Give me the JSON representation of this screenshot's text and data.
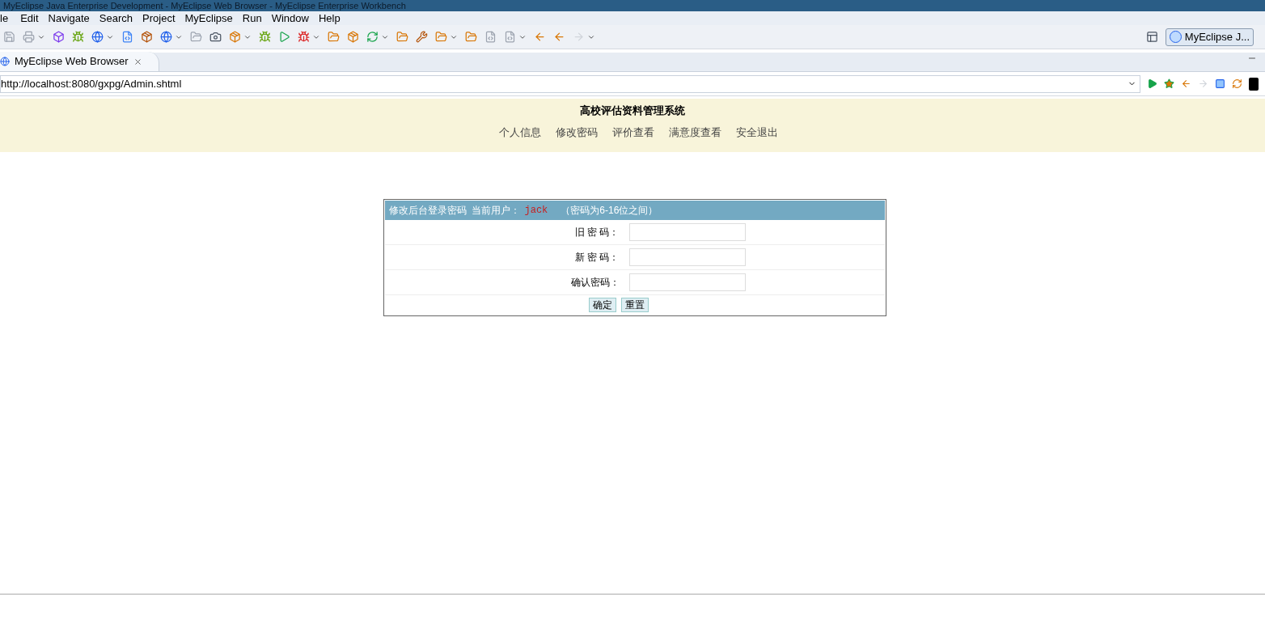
{
  "window": {
    "title": "MyEclipse Java Enterprise Development - MyEclipse Web Browser - MyEclipse Enterprise Workbench"
  },
  "menu": [
    "le",
    "Edit",
    "Navigate",
    "Search",
    "Project",
    "MyEclipse",
    "Run",
    "Window",
    "Help"
  ],
  "perspective": {
    "label": "MyEclipse J..."
  },
  "tabs": [
    {
      "label": "MyEclipse Web Browser",
      "selected": true
    }
  ],
  "address": {
    "value": "http://localhost:8080/gxpg/Admin.shtml"
  },
  "page": {
    "title": "高校评估资料管理系统",
    "nav": [
      "个人信息",
      "修改密码",
      "评价查看",
      "满意度查看",
      "安全退出"
    ],
    "form": {
      "heading": "修改后台登录密码",
      "user_label": "当前用户：",
      "user": "jack",
      "hint": "（密码为6-16位之间）",
      "fields": [
        {
          "label": "旧 密 码："
        },
        {
          "label": "新 密 码："
        },
        {
          "label": "确认密码："
        }
      ],
      "buttons": [
        "确定",
        "重置"
      ]
    }
  }
}
